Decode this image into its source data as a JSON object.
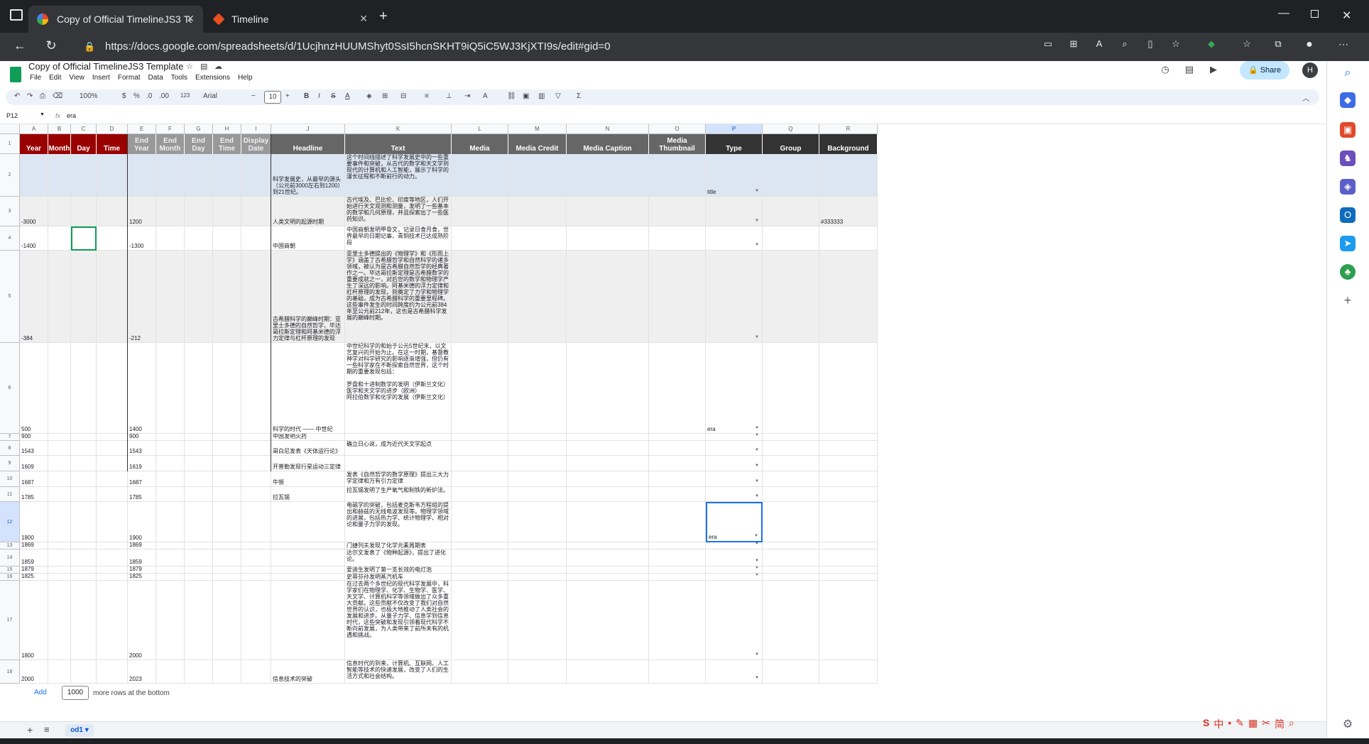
{
  "browser": {
    "tabs": [
      {
        "title": "Copy of Official TimelineJS3 Temp"
      },
      {
        "title": "Timeline"
      }
    ],
    "url": "https://docs.google.com/spreadsheets/d/1UcjhnzHUUMShyt0SsI5hcnSKHT9iQ5iC5WJ3KjXTI9s/edit#gid=0"
  },
  "sheet": {
    "title": "Copy of Official TimelineJS3 Template",
    "menus": [
      "File",
      "Edit",
      "View",
      "Insert",
      "Format",
      "Data",
      "Tools",
      "Extensions",
      "Help"
    ],
    "share_label": "Share",
    "avatar_initial": "H",
    "toolbar": {
      "zoom": "100%",
      "currency": "$",
      "percent": "%",
      "dec_minus": ".0",
      "dec_plus": ".00",
      "number_format": "123",
      "font": "Arial",
      "font_size": "10",
      "bold": "B",
      "italic": "I",
      "strike": "S",
      "textcolor": "A"
    },
    "name_box": "P12",
    "formula_label": "fx",
    "formula": "era"
  },
  "grid": {
    "columns": [
      "A",
      "B",
      "C",
      "D",
      "E",
      "F",
      "G",
      "H",
      "I",
      "J",
      "K",
      "L",
      "M",
      "N",
      "O",
      "P",
      "Q",
      "R"
    ],
    "headers": [
      "Year",
      "Month",
      "Day",
      "Time",
      "End Year",
      "End Month",
      "End Day",
      "End Time",
      "Display Date",
      "Headline",
      "Text",
      "Media",
      "Media Credit",
      "Media Caption",
      "Media Thumbnail",
      "Type",
      "Group",
      "Background"
    ],
    "rows": [
      {
        "num": "2",
        "year": "",
        "end_year": "",
        "headline": "科学发展史，从最早的源头（公元前3000左右到1200）到21世纪。",
        "text": "这个时间线描述了科学发展史中的一些重要事件和突破，从古代的数学和天文学到现代的计算机和人工智能，展示了科学的漫长征程和不断前行的动力。",
        "type": "title",
        "background": ""
      },
      {
        "num": "3",
        "year": "-3000",
        "end_year": "1200",
        "headline": "人类文明的起源时期",
        "text": "古代埃及、巴比伦、印度等地区，人们开始进行天文观测和测量，发明了一些基本的数学和几何原理，并且探索出了一些医药知识。",
        "type": "",
        "background": "#333333"
      },
      {
        "num": "4",
        "year": "-1400",
        "end_year": "-1300",
        "headline": "中国商朝",
        "text": "中国商朝发明甲骨文，记录日食月食，世界最早的日期记事，青铜技术已达成熟阶段",
        "type": "",
        "background": ""
      },
      {
        "num": "5",
        "year": "-384",
        "end_year": "-212",
        "headline": "古希腊科学的巅峰时期：亚里士多德的自然哲学、毕达哥拉斯定理和阿基米德的浮力定律与杠杆原理的发现",
        "text": "亚里士多德提出的《物理学》和《形而上学》涵盖了古希腊哲学和自然科学的诸多领域，被认为是古希腊自然哲学的经典著作之一。毕达哥拉斯定理是古希腊数学的重要成就之一，对后世的数学和物理学产生了深远的影响。阿基米德的浮力定律和杠杆原理的发现，则奠定了力学和物理学的基础，成为古希腊科学的重要里程碑。这些事件发生的时间跨度约为公元前384年至公元前212年，这也是古希腊科学发展的巅峰时期。",
        "type": "",
        "background": ""
      },
      {
        "num": "6",
        "year": "500",
        "end_year": "1400",
        "headline": "科学的时代 —— 中世纪",
        "text": "中世纪科学的和始于公元5世纪末，以文艺复兴的开始为止。在这一时期，基督教神学对科学研究的影响逐渐增强，但仍有一些科学家在不断探索自然世界，这个时期的重要发现包括：\n\n罗盘和十进制数学的发明（伊斯兰文化）\n医学和天文学的进步（欧洲）\n阿拉伯数学和化学的发展（伊斯兰文化）",
        "type": "era",
        "background": ""
      },
      {
        "num": "7",
        "year": "900",
        "end_year": "900",
        "headline": "中国发明火药",
        "text": "",
        "type": "",
        "background": ""
      },
      {
        "num": "8",
        "year": "1543",
        "end_year": "1543",
        "headline": "哥白尼发表《天体运行论》",
        "text": "确立日心说，成为近代天文学起点",
        "type": "",
        "background": ""
      },
      {
        "num": "9",
        "year": "1609",
        "end_year": "1619",
        "headline": "开普勒发现行星运动三定律",
        "text": "",
        "type": "",
        "background": ""
      },
      {
        "num": "10",
        "year": "1687",
        "end_year": "1687",
        "headline": "牛顿",
        "text": "发表《自然哲学的数学原理》提出三大力学定律和万有引力定律",
        "type": "",
        "background": ""
      },
      {
        "num": "11",
        "year": "1785",
        "end_year": "1785",
        "headline": "拉瓦锡",
        "text": "拉瓦锡发明了生产氧气和制铁的新炉法。",
        "type": "",
        "background": ""
      },
      {
        "num": "12",
        "year": "1800",
        "end_year": "1900",
        "headline": "",
        "text": "电磁学的突破，包括麦克斯韦方程组的提出和赫兹的无线电波发现等。物理学领域的进展，包括热力学、统计物理学、相对论和量子力学的发现。",
        "type": "era",
        "background": ""
      },
      {
        "num": "13",
        "year": "1869",
        "end_year": "1869",
        "headline": "",
        "text": "门捷列夫发现了化学元素周期表",
        "type": "",
        "background": ""
      },
      {
        "num": "14",
        "year": "1859",
        "end_year": "1859",
        "headline": "",
        "text": "达尔文发表了《物种起源》，提出了进化论。",
        "type": "",
        "background": ""
      },
      {
        "num": "15",
        "year": "1879",
        "end_year": "1879",
        "headline": "",
        "text": "爱迪生发明了第一支长效的电灯泡",
        "type": "",
        "background": ""
      },
      {
        "num": "16",
        "year": "1825",
        "end_year": "1825",
        "headline": "",
        "text": "史蒂芬孙发明蒸汽机车",
        "type": "",
        "background": ""
      },
      {
        "num": "17",
        "year": "1800",
        "end_year": "2000",
        "headline": "",
        "text": "在过去两个多世纪的现代科学发展中，科学家们在物理学、化学、生物学、医学、天文学、计算机科学等领域做出了众多重大贡献。这些贡献不仅改变了我们对自然世界的认识，也极大地推动了人类社会的发展和进步。从量子力学、信息学到信息时代，这些突破和发现引领着现代科学不断向前发展，为人类带来了前所未有的机遇和挑战。",
        "type": "",
        "background": ""
      },
      {
        "num": "18",
        "year": "2000",
        "end_year": "2023",
        "headline": "信息技术的突破",
        "text": "信息时代的到来，计算机、互联网、人工智能等技术的快速发展，改变了人们的生活方式和社会结构。",
        "type": "",
        "background": ""
      }
    ]
  },
  "footer": {
    "add_label": "Add",
    "rows_value": "1000",
    "rows_text": "more rows at the bottom",
    "sheet_tab": "od1"
  }
}
